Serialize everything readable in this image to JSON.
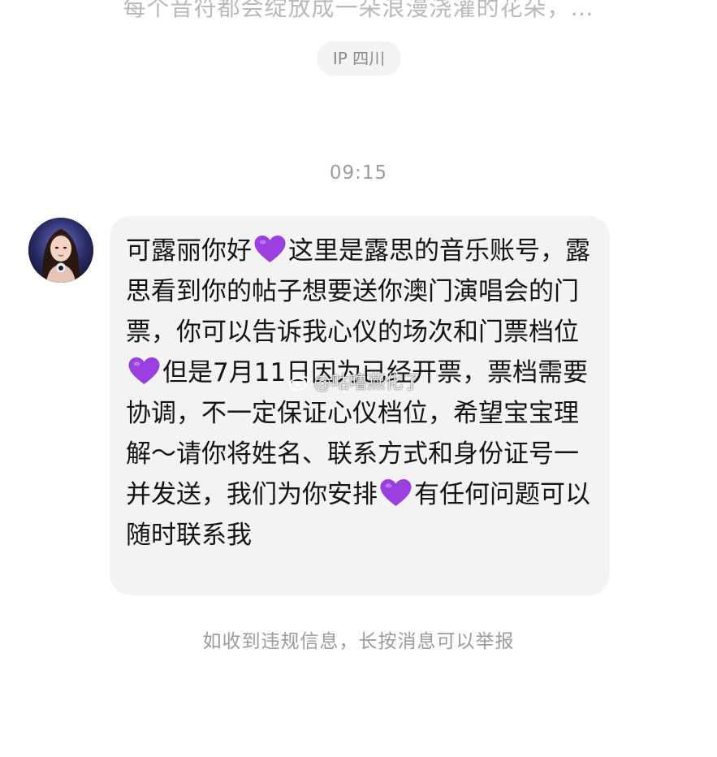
{
  "previous_message": {
    "text": "每个音符都会绽放成一朵浪漫浇灌的花朵，…"
  },
  "ip_location": {
    "label": "IP 四川"
  },
  "timestamp": "09:15",
  "message": {
    "segments": [
      "可露丽你好",
      "这里是露思的音乐账号，露思看到你的帖子想要送你澳门演唱会的门票，你可以告诉我心仪的场次和门票档位",
      "但是7月11日因为已经开票，票档需要协调，不一定保证心仪档位，希望宝宝理解～请你将姓名、联系方式和身份证号一并发送，我们为你安排",
      "有任何问题可以随时联系我"
    ],
    "emoji": "purple-heart"
  },
  "watermark": {
    "text": "@咕噜燕化了"
  },
  "report_hint": "如收到违规信息，长按消息可以举报",
  "colors": {
    "heart": "#9b3fe0",
    "bubble": "#f3f3f4",
    "muted_text": "#9b9b9b"
  }
}
